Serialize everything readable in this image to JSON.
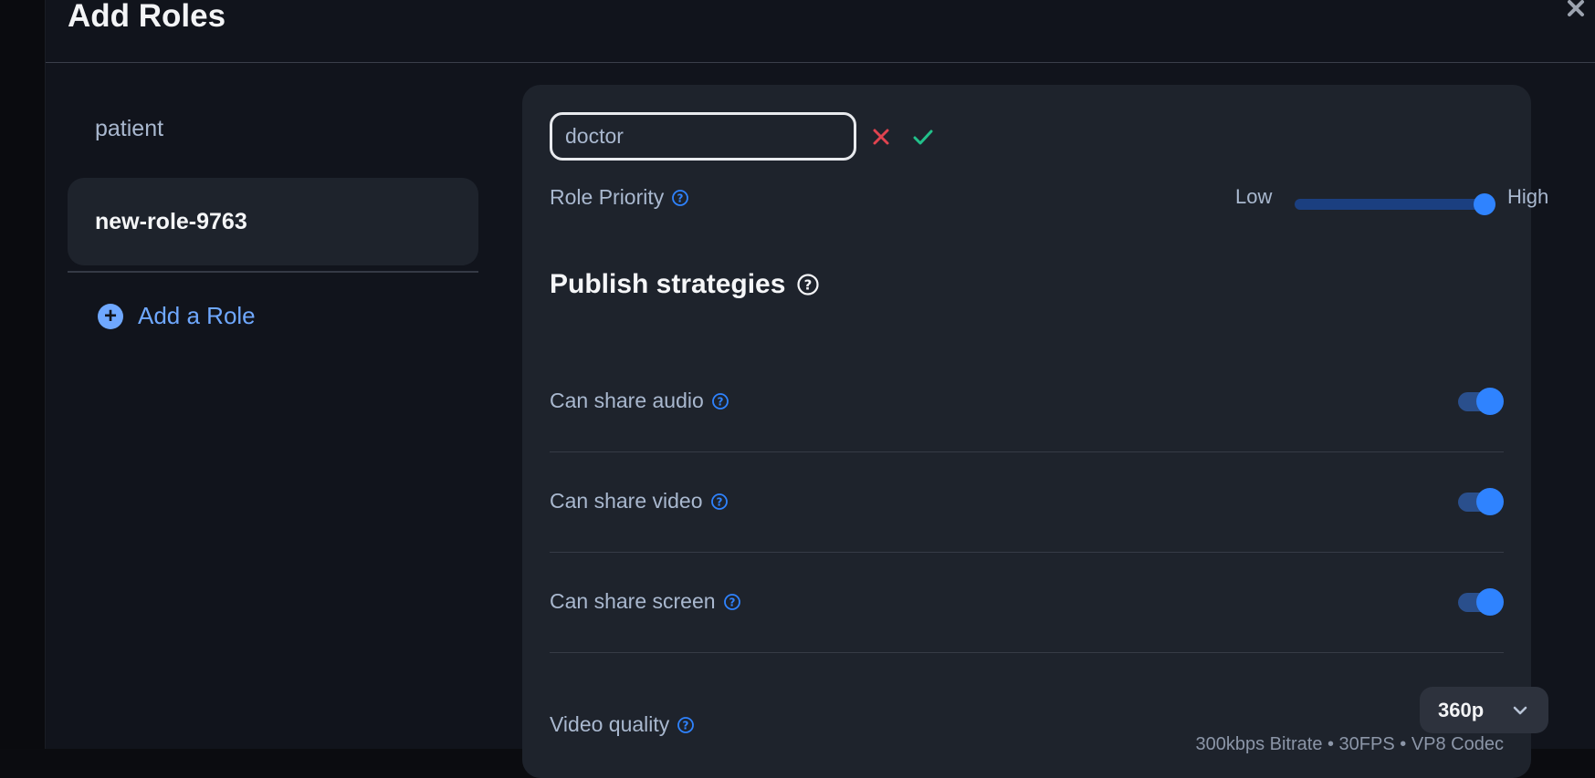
{
  "modal": {
    "title": "Add Roles",
    "close_icon": "close-icon"
  },
  "roles": {
    "items": [
      {
        "label": "patient",
        "active": false
      },
      {
        "label": "new-role-9763",
        "active": true
      }
    ],
    "add_label": "Add a Role"
  },
  "editor": {
    "name_value": "doctor",
    "name_placeholder": "",
    "cancel_icon": "x-icon",
    "confirm_icon": "check-icon",
    "priority": {
      "label": "Role Priority",
      "low_label": "Low",
      "high_label": "High",
      "value_fraction": 1.0
    },
    "section_title": "Publish strategies",
    "permissions": [
      {
        "label": "Can share audio",
        "enabled": true
      },
      {
        "label": "Can share video",
        "enabled": true
      },
      {
        "label": "Can share screen",
        "enabled": true
      }
    ],
    "video_quality": {
      "label": "Video quality",
      "selected": "360p",
      "details": "300kbps Bitrate • 30FPS • VP8 Codec"
    }
  },
  "colors": {
    "accent": "#2f83ff",
    "link": "#6fa8ff",
    "cancel": "#e0434f",
    "confirm": "#22c08a"
  }
}
